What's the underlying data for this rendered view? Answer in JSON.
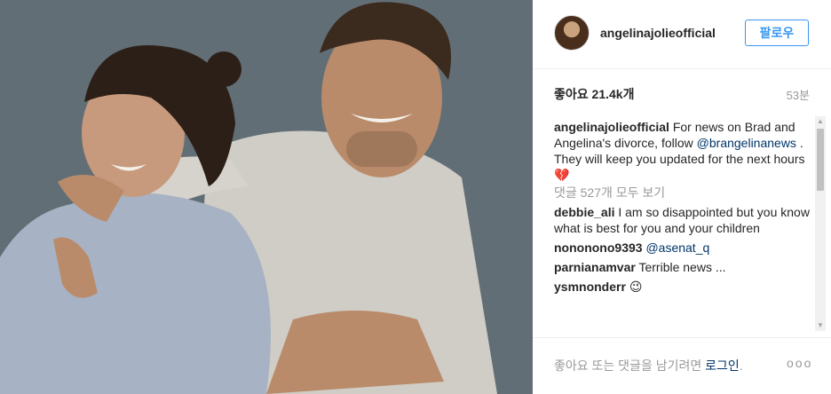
{
  "post": {
    "username": "angelinajolieofficial",
    "follow_label": "팔로우",
    "likes_label": "좋아요 21.4k개",
    "time_ago": "53분",
    "caption": {
      "user": "angelinajolieofficial",
      "text_before": "For news on Brad and Angelina's divorce, follow",
      "mention": "@brangelinanews",
      "text_after": ". They will keep you updated for the next hours",
      "emoji": "💔"
    },
    "view_all_comments": "댓글 527개 모두 보기",
    "comments": [
      {
        "user": "debbie_ali",
        "text": "I am so disappointed but you know what is best for you and your children"
      },
      {
        "user": "nononono9393",
        "text": "@asenat_q"
      },
      {
        "user": "parnianamvar",
        "text": "Terrible news ..."
      },
      {
        "user": "ysmnonderr",
        "text": "😉"
      }
    ],
    "footer": {
      "prefix": "좋아요 또는 댓글을 남기려면",
      "login_link": "로그인",
      "suffix": ".",
      "more": "ooo"
    }
  },
  "colors": {
    "link": "#003569",
    "accent": "#3897f0",
    "muted": "#999999"
  }
}
